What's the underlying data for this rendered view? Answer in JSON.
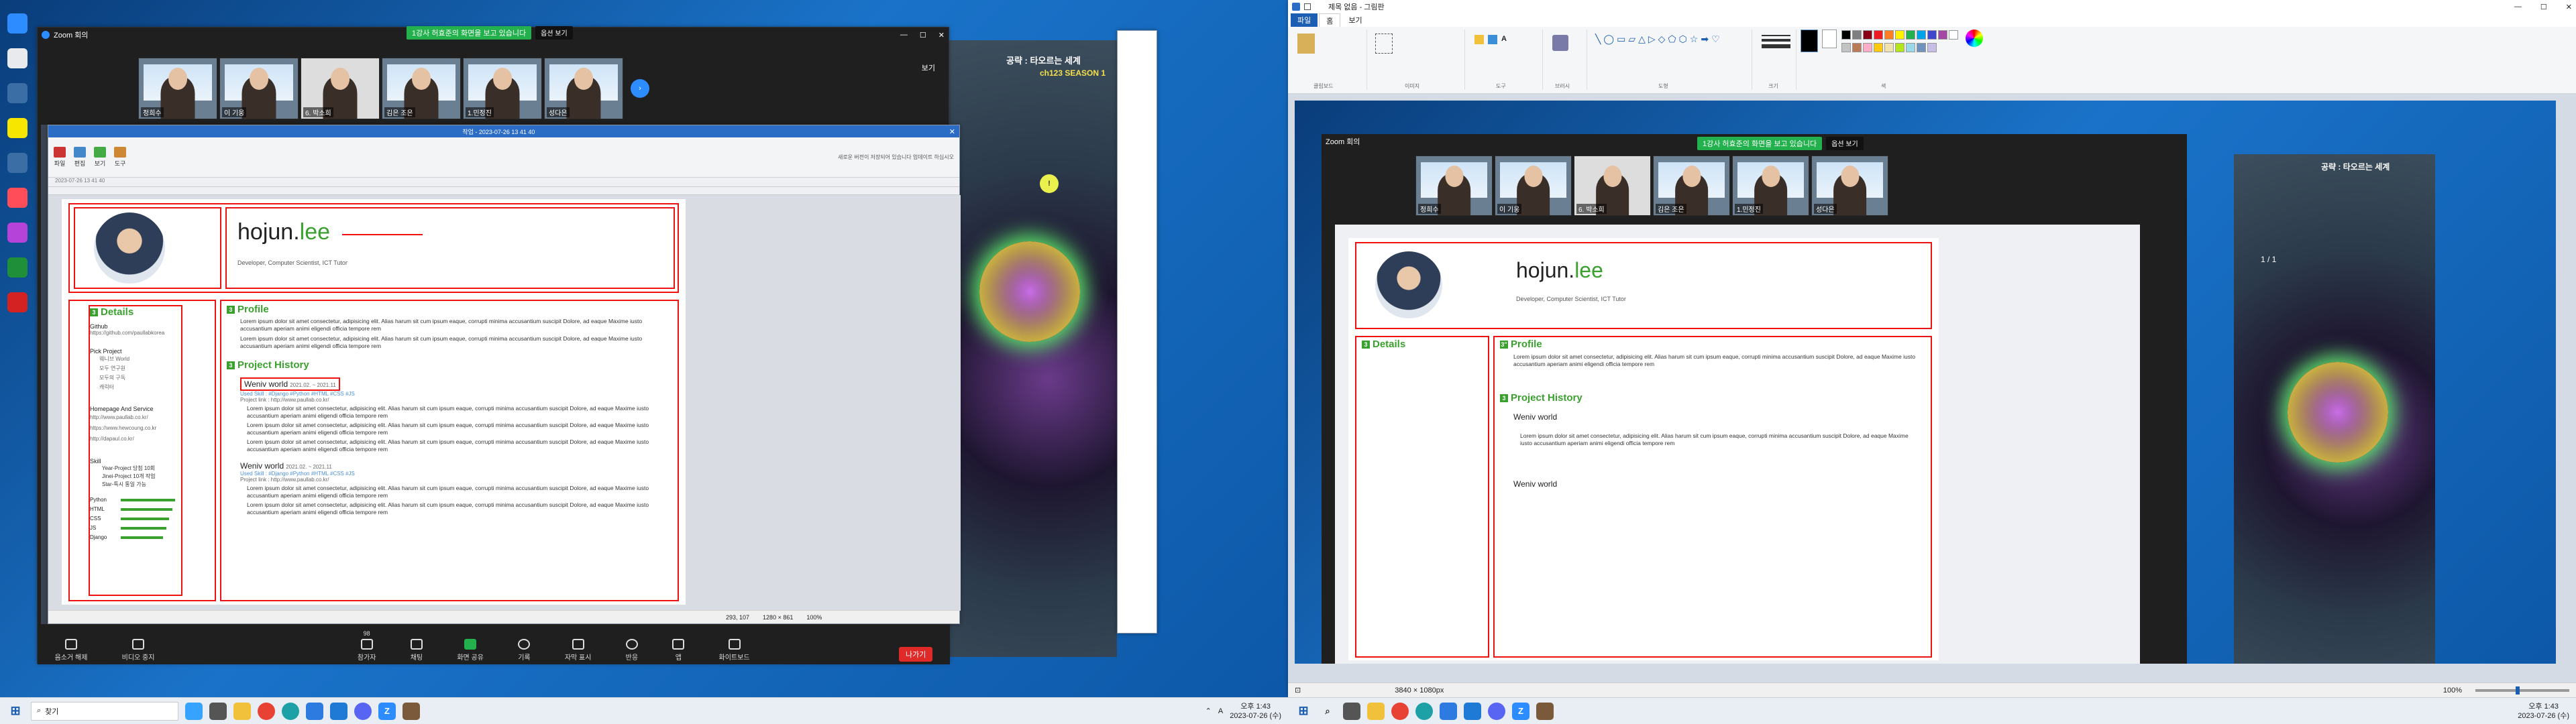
{
  "zoom": {
    "window_title": "Zoom 회의",
    "banner_text": "1강사 허효준의 화면을 보고 있습니다",
    "view_options": "옵션 보기",
    "view_label": "보기",
    "participants": [
      "정희수",
      "이 기웅",
      "6. 박소희",
      "김은 조은",
      "1.민정진",
      "성다은"
    ],
    "controls": [
      "음소거 해제",
      "비디오 중지",
      "참가자",
      "채팅",
      "화면 공유",
      "기록",
      "자막 표시",
      "반응",
      "앱",
      "화이트보드"
    ],
    "participant_count": "98",
    "end_label": "나가기"
  },
  "viewer": {
    "title": "작업 - 2023-07-26 13 41 40",
    "tab_label": "2023-07-26 13 41 40",
    "notice": "새로운 버전이 저장되어 있습니다 업데이트 하십시오",
    "menus": [
      "파일",
      "편집",
      "보기",
      "도구"
    ],
    "status_pos": "293, 107",
    "status_size": "1280 × 861",
    "zoom_pct": "100%"
  },
  "resume": {
    "name_black": "hojun.",
    "name_green": "lee",
    "subtitle": "Developer, Computer Scientist, ICT Tutor",
    "details_title": "Details",
    "github_label": "Github",
    "github_url": "https://github.com/paullabkorea",
    "pick_label": "Pick Project",
    "pick_items": [
      "웨니브 World",
      "모두 연구원",
      "모두의 구독",
      "캐릭터"
    ],
    "homepage_label": "Homepage And Service",
    "homepage_urls": [
      "http://www.paullab.co.kr/",
      "https://www.hewcoung.co.kr",
      "http://dapaul.co.kr/"
    ],
    "skill_label": "Skill",
    "skill_notes": [
      "Year-Project 당첨 10회",
      "Jinei-Project 10개 작업",
      "Star-특시 통일 가능"
    ],
    "skills": [
      {
        "name": "Python",
        "level": 0.9
      },
      {
        "name": "HTML",
        "level": 0.85
      },
      {
        "name": "CSS",
        "level": 0.8
      },
      {
        "name": "JS",
        "level": 0.75
      },
      {
        "name": "Django",
        "level": 0.7
      }
    ],
    "profile_title": "Profile",
    "profile_text": "Lorem ipsum dolor sit amet consectetur, adipisicing elit. Alias harum sit cum ipsum eaque, corrupti minima accusantium suscipit Dolore, ad eaque Maxime iusto accusantium aperiam animi eligendi officia tempore rem",
    "history_title": "Project History",
    "projects": [
      {
        "name": "Weniv world",
        "date": "2021.02. ~ 2021.11",
        "skills": "Used Skill : #Django #Python #HTML #CSS #JS",
        "link": "Project link : http://www.paullab.co.kr/"
      },
      {
        "name": "Weniv world",
        "date": "2021.02. ~ 2021.11",
        "skills": "Used Skill : #Django #Python #HTML #CSS #JS",
        "link": "Project link : http://www.paullab.co.kr/"
      }
    ],
    "lorem": "Lorem ipsum dolor sit amet consectetur, adipisicing elit. Alias harum sit cum ipsum eaque, corrupti minima accusantium suscipit Dolore, ad eaque Maxime iusto accusantium aperiam animi eligendi officia tempore rem"
  },
  "game": {
    "title": "공략 : 타오르는 세계",
    "subtitle": "ch123 SEASON 1",
    "page": "1 / 1"
  },
  "paint": {
    "title": "제목 없음 - 그림판",
    "tabs": [
      "파일",
      "홈",
      "보기"
    ],
    "groups": [
      "클립보드",
      "이미지",
      "도구",
      "브러시",
      "도형",
      "크기",
      "색"
    ],
    "status_size": "3840 × 1080px",
    "zoom_pct": "100%",
    "colors": [
      "#000000",
      "#7f7f7f",
      "#880015",
      "#ed1c24",
      "#ff7f27",
      "#fff200",
      "#22b14c",
      "#00a2e8",
      "#3f48cc",
      "#a349a4",
      "#ffffff",
      "#c3c3c3",
      "#b97a57",
      "#ffaec9",
      "#ffc90e",
      "#efe4b0",
      "#b5e61d",
      "#99d9ea",
      "#7092be",
      "#c8bfe7"
    ]
  },
  "taskbar": {
    "search": "찾기",
    "time": "오후 1:43",
    "date": "2023-07-26 (수)",
    "lang": "A"
  },
  "desktop_icons": [
    "Zoom",
    "Chrome",
    "TALK",
    "Adobe",
    "Google",
    "Acrobat"
  ]
}
